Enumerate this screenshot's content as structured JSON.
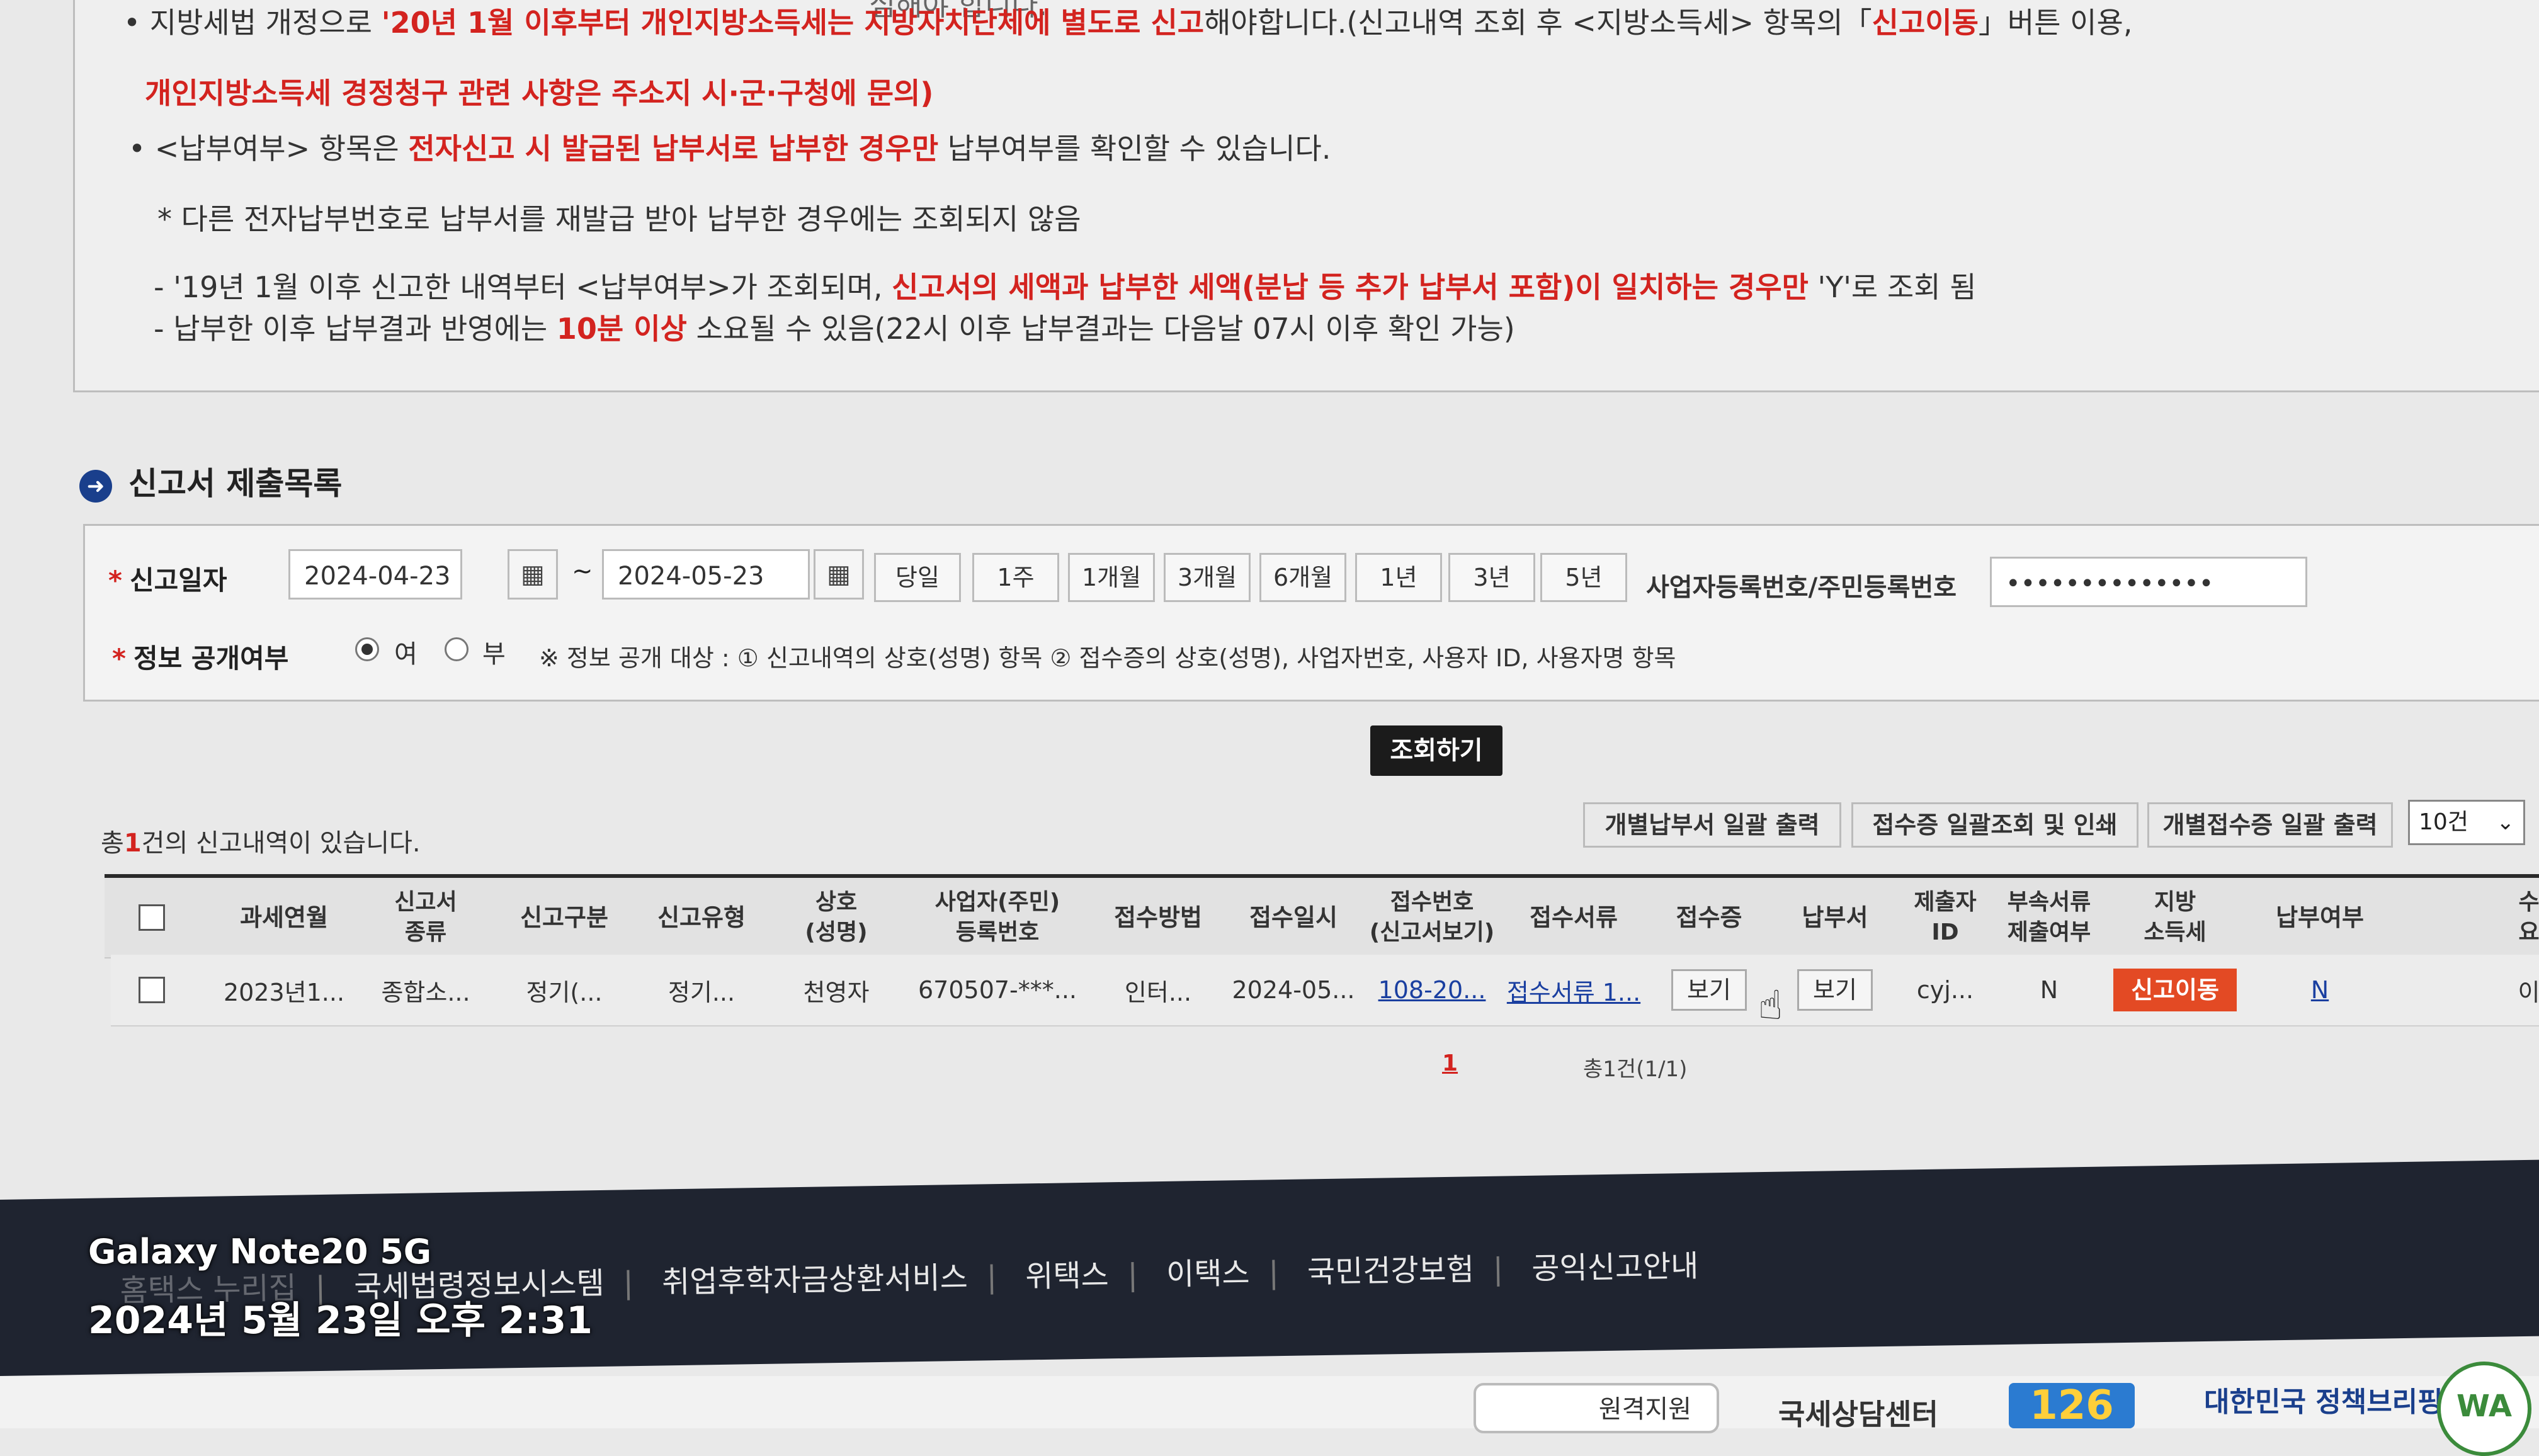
{
  "notice": {
    "line0": "심해야 합니다.",
    "line1_a": "지방세법 개정으로 ",
    "line1_b": "'20년 1월 이후부터 개인지방소득세는 지방자치단체에 별도로 신고",
    "line1_c": "해야합니다.(신고내역 조회 후 <지방소득세> 항목의「",
    "line1_d": "신고이동",
    "line1_e": "」버튼 이용,",
    "line2": "개인지방소득세 경정청구 관련 사항은 주소지 시·군·구청에 문의)",
    "line3_a": "<납부여부> 항목은 ",
    "line3_b": "전자신고 시 발급된 납부서로 납부한 경우만",
    "line3_c": " 납부여부를 확인할 수 있습니다.",
    "line4": "* 다른 전자납부번호로 납부서를 재발급 받아 납부한 경우에는 조회되지 않음",
    "line5_a": "- '19년 1월 이후 신고한 내역부터 <납부여부>가 조회되며, ",
    "line5_b": "신고서의 세액과 납부한 세액(분납 등 추가 납부서 포함)이 일치하는 경우만",
    "line5_c": " 'Y'로 조회 됨",
    "line6_a": "- 납부한 이후 납부결과 반영에는 ",
    "line6_b": "10분 이상",
    "line6_c": " 소요될 수 있음(22시 이후 납부결과는 다음날 07시 이후 확인 가능)"
  },
  "section_title": "신고서 제출목록",
  "section_icon": "arrow-circle-icon",
  "filter": {
    "date_label": "신고일자",
    "start_date": "2024-04-23",
    "end_date": "2024-05-23",
    "tilde": "~",
    "periods": [
      "당일",
      "1주",
      "1개월",
      "3개월",
      "6개월",
      "1년",
      "3년",
      "5년"
    ],
    "id_label": "사업자등록번호/주민등록번호",
    "id_value": "••••••••••••••",
    "public_label": "정보 공개여부",
    "radio_yes": "여",
    "radio_no": "부",
    "public_note": "※ 정보 공개 대상 : ① 신고내역의 상호(성명) 항목 ② 접수증의 상호(성명), 사업자번호, 사용자 ID, 사용자명 항목"
  },
  "search_button": "조회하기",
  "result_count": {
    "prefix": "총",
    "num": "1",
    "suffix": "건의 신고내역이 있습니다."
  },
  "table_buttons": [
    "개별납부서 일괄 출력",
    "접수증 일괄조회 및 인쇄",
    "개별접수증 일괄 출력"
  ],
  "page_size": "10건",
  "columns": [
    "과세연월",
    "신고서\n종류",
    "신고구분",
    "신고유형",
    "상호\n(성명)",
    "사업자(주민)\n등록번호",
    "접수방법",
    "접수일시",
    "접수번호\n(신고서보기)",
    "접수서류",
    "접수증",
    "납부서",
    "제출자\nID",
    "부속서류\n제출여부",
    "지방\n소득세",
    "납부여부",
    "수\n요"
  ],
  "row": {
    "period": "2023년1...",
    "form_type": "종합소...",
    "category": "정기(...",
    "type": "정기...",
    "name": "천영자",
    "reg_no": "670507-***...",
    "method": "인터...",
    "date": "2024-05...",
    "receipt_no": "108-20...",
    "docs": "접수서류 1...",
    "receipt_btn": "보기",
    "bill_btn": "보기",
    "submitter": "cyj...",
    "attached": "N",
    "local_tax_btn": "신고이동",
    "paid": "N",
    "extra": "이"
  },
  "pager": {
    "page": "1",
    "total": "총1건(1/1)"
  },
  "footer_links": [
    "홈택스 누리집",
    "국세법령정보시스템",
    "취업후학자금상환서비스",
    "위택스",
    "이택스",
    "국민건강보험",
    "공익신고안내"
  ],
  "bottom": {
    "help": "원격지원",
    "center": "국세상담센터",
    "logo_126": "126",
    "policy": "대한민국 정책브리핑",
    "wa": "WA"
  },
  "overlay": {
    "device": "Galaxy Note20 5G",
    "timestamp": "2024년 5월 23일 오후 2:31"
  }
}
